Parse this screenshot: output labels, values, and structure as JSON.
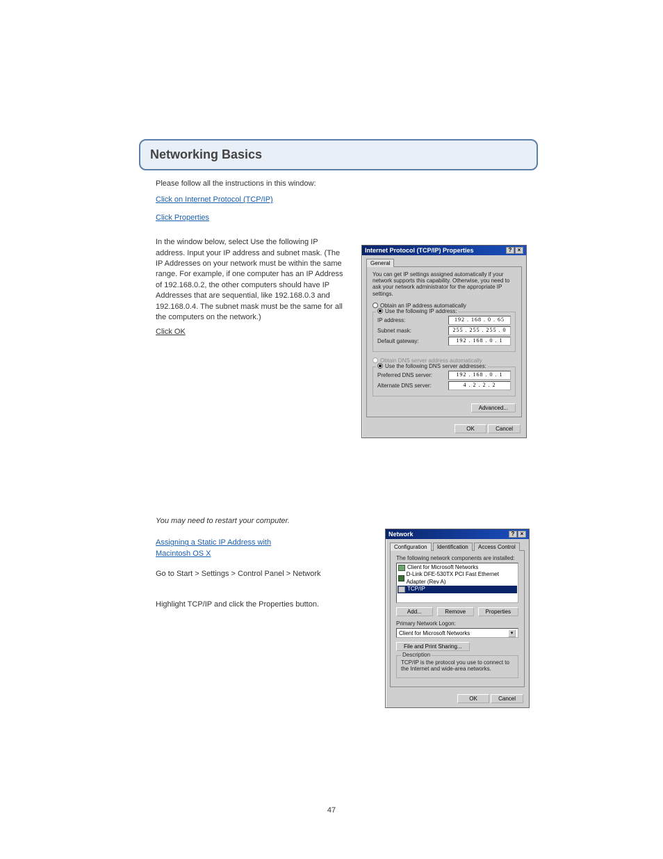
{
  "page_number": "47",
  "appendix_title": "Networking Basics",
  "intro_text": "Please follow all the instructions in this window:",
  "intro_link_head": "Click on Internet Protocol (TCP/IP)",
  "intro_link_sub": "Click Properties",
  "win2000": {
    "heading": "In the window below, select Use the following IP address. Input your IP address and subnet mask. (The IP Addresses on your network must be within the same range. For example, if one computer has an IP Address of 192.168.0.2, the other computers should have IP Addresses that are sequential, like 192.168.0.3 and 192.168.0.4. The subnet mask must be the same for all the computers on the network.)",
    "click_ok": "Click OK",
    "restart": "You may need to restart your computer."
  },
  "tcpip_dialog": {
    "title": "Internet Protocol (TCP/IP) Properties",
    "help_btn": "?",
    "close_btn": "×",
    "tab": "General",
    "desc": "You can get IP settings assigned automatically if your network supports this capability. Otherwise, you need to ask your network administrator for the appropriate IP settings.",
    "obtain_ip": "Obtain an IP address automatically",
    "use_ip": "Use the following IP address:",
    "ip_label": "IP address:",
    "ip_value": "192 . 168 .  0  . 65",
    "subnet_label": "Subnet mask:",
    "subnet_value": "255 . 255 . 255 .  0",
    "gateway_label": "Default gateway:",
    "gateway_value": "192 . 168 .  0  .  1",
    "obtain_dns": "Obtain DNS server address automatically",
    "use_dns": "Use the following DNS server addresses:",
    "pref_dns_label": "Preferred DNS server:",
    "pref_dns_value": "192 . 168 .  0  .  1",
    "alt_dns_label": "Alternate DNS server:",
    "alt_dns_value": "  4 .  2  .  2  .  2",
    "advanced": "Advanced...",
    "ok": "OK",
    "cancel": "Cancel"
  },
  "winme_heading": "Assigning a Static IP Address with",
  "winme_sub": "Macintosh OS X",
  "winme_steps": {
    "s1": "Go to Start > Settings > Control Panel > Network",
    "s2": "Highlight TCP/IP and click the Properties button."
  },
  "network_dialog": {
    "title": "Network",
    "help_btn": "?",
    "close_btn": "×",
    "tab1": "Configuration",
    "tab2": "Identification",
    "tab3": "Access Control",
    "installed_label": "The following network components are installed:",
    "item1": "Client for Microsoft Networks",
    "item2": "D-Link DFE-530TX PCI Fast Ethernet Adapter (Rev A)",
    "item3": "TCP/IP",
    "add": "Add...",
    "remove": "Remove",
    "properties": "Properties",
    "logon_label": "Primary Network Logon:",
    "logon_value": "Client for Microsoft Networks",
    "file_share": "File and Print Sharing...",
    "desc_label": "Description",
    "desc_text": "TCP/IP is the protocol you use to connect to the Internet and wide-area networks.",
    "ok": "OK",
    "cancel": "Cancel"
  }
}
